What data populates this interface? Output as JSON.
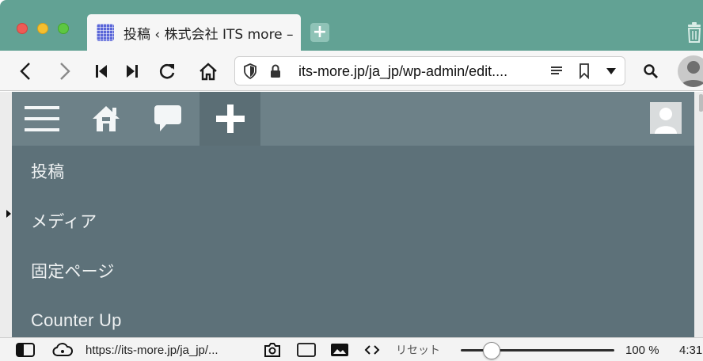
{
  "window": {
    "tab_title": "投稿 ‹ 株式会社 ITS more –",
    "new_tab_label": "+"
  },
  "toolbar": {
    "url": "its-more.jp/ja_jp/wp-admin/edit...."
  },
  "admin_bar": {
    "items": [
      "menu-icon",
      "home-icon",
      "comment-icon",
      "plus-icon",
      "user-avatar"
    ]
  },
  "admin_menu": {
    "items": [
      {
        "label": "投稿"
      },
      {
        "label": "メディア"
      },
      {
        "label": "固定ページ"
      },
      {
        "label": "Counter Up"
      }
    ]
  },
  "status_bar": {
    "link_url": "https://its-more.jp/ja_jp/...",
    "reset_label": "リセット",
    "zoom_level": "100 %",
    "zoom_fraction": 0.2,
    "clock": "4:31"
  },
  "colors": {
    "tab_strip": "#62a294",
    "admin_bar": "#6d8188",
    "admin_menu": "#5d7179"
  }
}
